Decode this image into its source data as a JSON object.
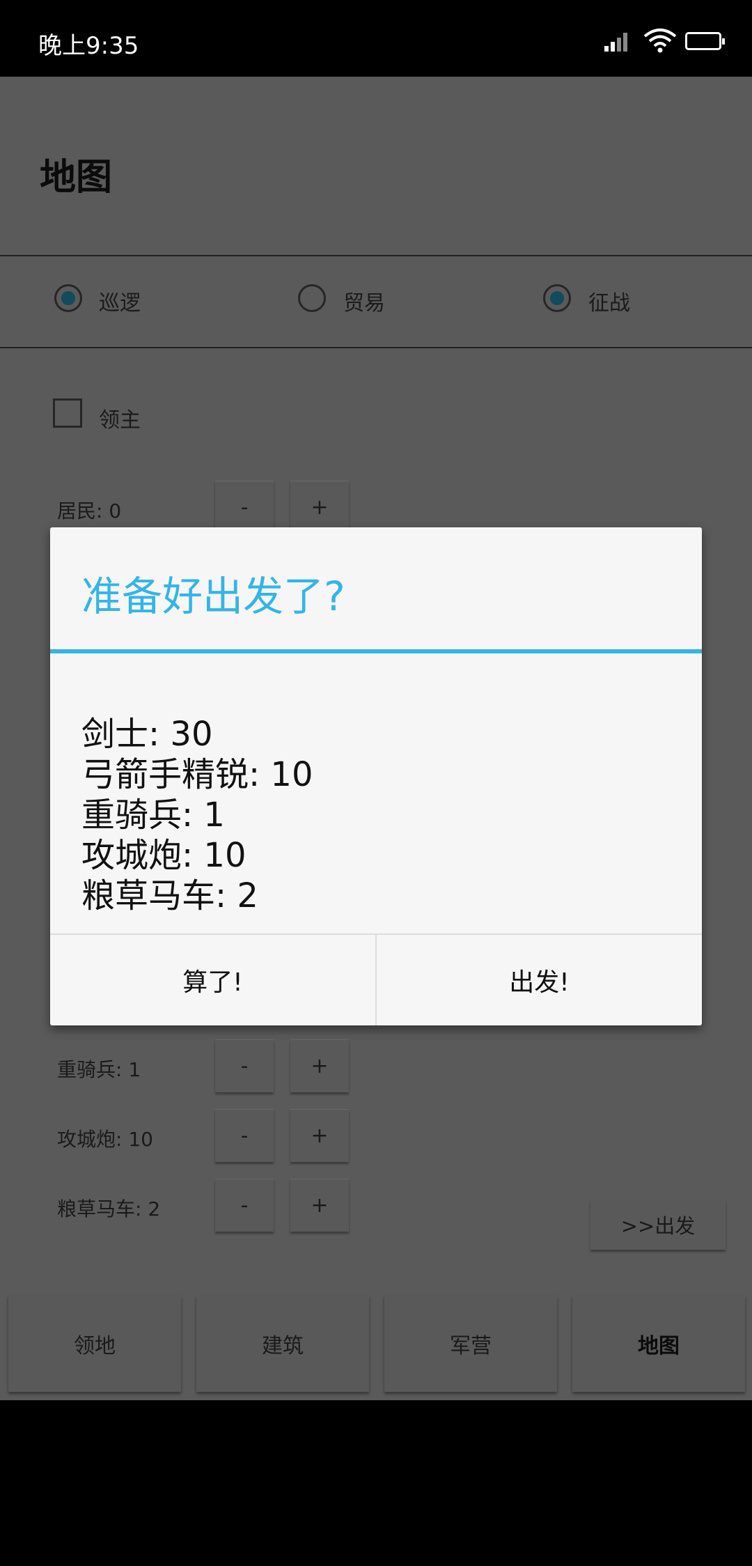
{
  "status": {
    "time": "晚上9:35"
  },
  "page": {
    "title": "地图"
  },
  "modes": [
    {
      "label": "巡逻",
      "checked": true
    },
    {
      "label": "贸易",
      "checked": false
    },
    {
      "label": "征战",
      "checked": true
    }
  ],
  "lord": {
    "label": "领主",
    "checked": false
  },
  "units": {
    "residents": "居民: 0",
    "heavy_cavalry": "重骑兵: 1",
    "siege_cannon": "攻城炮: 10",
    "supply_cart": "粮草马车: 2"
  },
  "stepper": {
    "minus": "-",
    "plus": "+"
  },
  "depart_button": ">>出发",
  "nav": [
    {
      "label": "领地"
    },
    {
      "label": "建筑"
    },
    {
      "label": "军营"
    },
    {
      "label": "地图"
    }
  ],
  "dialog": {
    "title": "准备好出发了?",
    "lines": [
      "剑士: 30",
      "弓箭手精锐: 10",
      "重骑兵: 1",
      "攻城炮: 10",
      "粮草马车: 2"
    ],
    "cancel": "算了!",
    "confirm": "出发!"
  },
  "colors": {
    "accent": "#33b5e5",
    "overlay_bg": "#5a5a5a",
    "dialog_bg": "#f6f6f6"
  }
}
